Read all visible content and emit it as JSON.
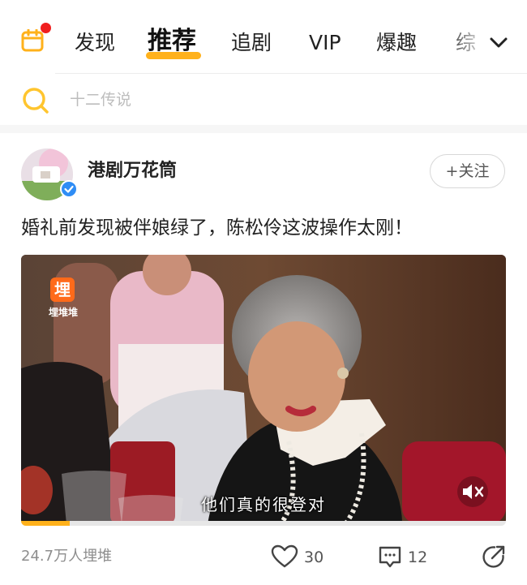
{
  "nav": {
    "tabs": [
      {
        "label": "发现",
        "active": false
      },
      {
        "label": "推荐",
        "active": true
      },
      {
        "label": "追剧",
        "active": false
      },
      {
        "label": "VIP",
        "active": false
      },
      {
        "label": "爆趣",
        "active": false
      },
      {
        "label": "综",
        "active": false
      }
    ],
    "calendar_icon": "calendar-icon",
    "notification_dot_color": "#f01e1e",
    "more_icon": "chevron-down-icon",
    "accent_color": "#ffb11b"
  },
  "search": {
    "placeholder": "十二传说",
    "icon": "search-icon"
  },
  "post": {
    "author": "港剧万花筒",
    "verified": true,
    "follow_label": "+关注",
    "title": "婚礼前发现被伴娘绿了，陈松伶这波操作太刚！",
    "video": {
      "watermark_logo_char": "埋",
      "watermark_text": "埋堆堆",
      "subtitle": "他们真的很登对",
      "muted": true,
      "progress": 0.1
    },
    "views": "24.7万人埋堆",
    "likes": "30",
    "comments": "12",
    "share_icon": "share-icon"
  }
}
